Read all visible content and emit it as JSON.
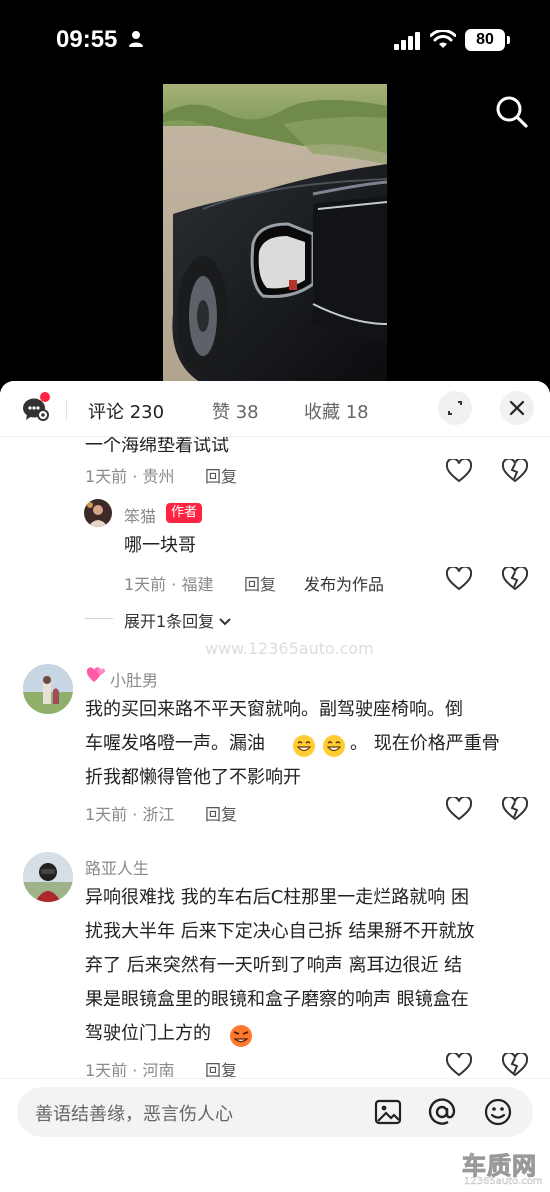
{
  "status_bar": {
    "time": "09:55",
    "battery": "80"
  },
  "sheet": {
    "tabs": [
      {
        "label": "评论 230"
      },
      {
        "label": "赞 38"
      },
      {
        "label": "收藏 18"
      }
    ]
  },
  "comments": {
    "truncated_text": "一个海绵垫着试试",
    "first": {
      "meta": "1天前 · 贵州",
      "reply": "回复"
    },
    "author_reply": {
      "name": "笨猫",
      "badge": "作者",
      "text": "哪一块哥",
      "meta": "1天前 · 福建",
      "reply": "回复",
      "publish": "发布为作品"
    },
    "expand": "展开1条回复",
    "second": {
      "name": "小肚男",
      "lines": [
        "我的买回来路不平天窗就响。副驾驶座椅响。倒",
        "车喔发咯噔一声。漏油",
        "。 现在价格严重骨",
        "折我都懒得管他了不影响开"
      ],
      "meta": "1天前 · 浙江",
      "reply": "回复"
    },
    "third": {
      "name": "路亚人生",
      "lines": [
        "异响很难找 我的车右后C柱那里一走烂路就响 困",
        "扰我大半年 后来下定决心自己拆 结果掰不开就放",
        "弃了 后来突然有一天听到了响声 离耳边很近 结",
        "果是眼镜盒里的眼镜和盒子磨察的响声 眼镜盒在",
        "驾驶位门上方的"
      ],
      "meta": "1天前 · 河南",
      "reply": "回复"
    }
  },
  "watermark": "www.12365auto.com",
  "input": {
    "placeholder": "善语结善缘，恶言伤人心"
  },
  "logo": {
    "main": "车质网",
    "sub": "12365auto.com"
  },
  "icons": {
    "status": [
      "person-icon",
      "signal-icon",
      "wifi-icon"
    ],
    "header": [
      "chat-icon",
      "expand-icon",
      "close-icon"
    ],
    "actions": [
      "heart-icon",
      "broken-heart-icon"
    ],
    "input": [
      "image-icon",
      "at-icon",
      "emoji-icon"
    ]
  }
}
